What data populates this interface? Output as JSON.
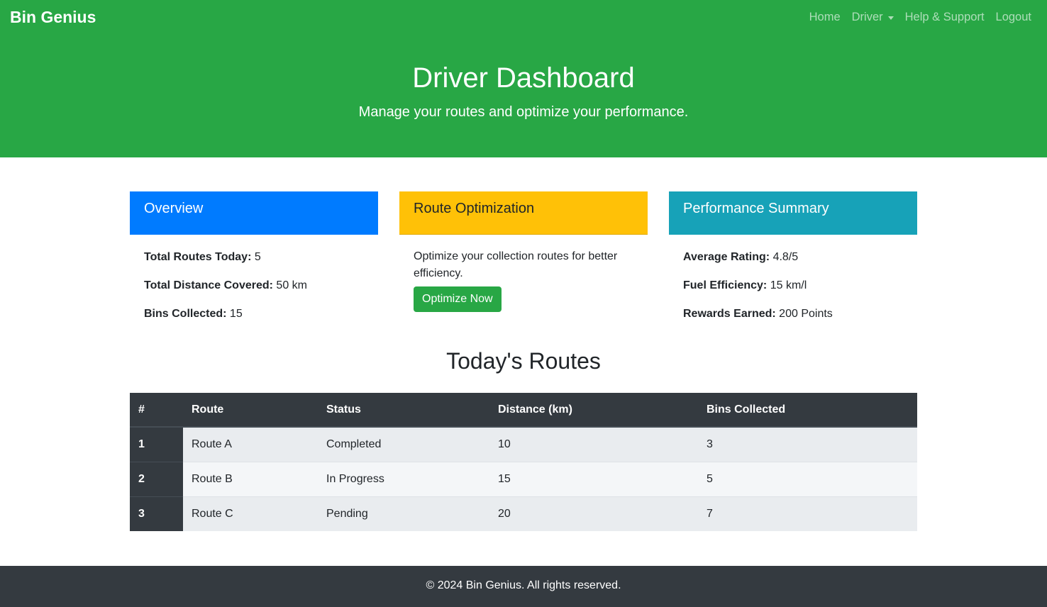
{
  "navbar": {
    "brand": "Bin Genius",
    "links": {
      "home": "Home",
      "driver": "Driver",
      "help": "Help & Support",
      "logout": "Logout"
    }
  },
  "hero": {
    "title": "Driver Dashboard",
    "subtitle": "Manage your routes and optimize your performance."
  },
  "cards": {
    "overview": {
      "title": "Overview",
      "stats": [
        {
          "label": "Total Routes Today:",
          "value": "5"
        },
        {
          "label": "Total Distance Covered:",
          "value": "50 km"
        },
        {
          "label": "Bins Collected:",
          "value": "15"
        }
      ]
    },
    "route_optimization": {
      "title": "Route Optimization",
      "text": "Optimize your collection routes for better efficiency.",
      "button_label": "Optimize Now"
    },
    "performance": {
      "title": "Performance Summary",
      "stats": [
        {
          "label": "Average Rating:",
          "value": "4.8/5"
        },
        {
          "label": "Fuel Efficiency:",
          "value": "15 km/l"
        },
        {
          "label": "Rewards Earned:",
          "value": "200 Points"
        }
      ]
    }
  },
  "routes": {
    "title": "Today's Routes",
    "columns": [
      "#",
      "Route",
      "Status",
      "Distance (km)",
      "Bins Collected"
    ],
    "rows": [
      [
        "1",
        "Route A",
        "Completed",
        "10",
        "3"
      ],
      [
        "2",
        "Route B",
        "In Progress",
        "15",
        "5"
      ],
      [
        "3",
        "Route C",
        "Pending",
        "20",
        "7"
      ]
    ]
  },
  "footer": {
    "text": "© 2024 Bin Genius. All rights reserved."
  },
  "colors": {
    "brand_green": "#28a745",
    "primary_blue": "#007bff",
    "warning_yellow": "#ffc107",
    "info_teal": "#17a2b8",
    "dark": "#343a40"
  }
}
